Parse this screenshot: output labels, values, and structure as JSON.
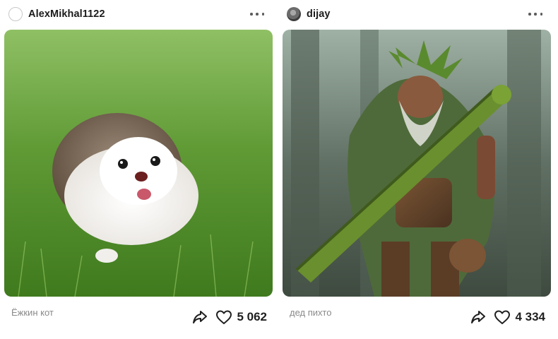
{
  "posts": [
    {
      "username": "AlexMikhal1122",
      "avatar_style": "empty-circle",
      "image_subject": "hedgehog-on-grass",
      "caption": "Ёжкин кот",
      "likes": "5 062"
    },
    {
      "username": "dijay",
      "avatar_style": "photo",
      "image_subject": "forest-warrior-with-mossy-club",
      "caption": "дед пихто",
      "likes": "4 334"
    }
  ],
  "icons": {
    "more": "more-dots-icon",
    "share": "share-arrow-icon",
    "like": "heart-icon"
  },
  "colors": {
    "text_primary": "#1f1f1f",
    "caption_gray": "#8a8a8a"
  }
}
